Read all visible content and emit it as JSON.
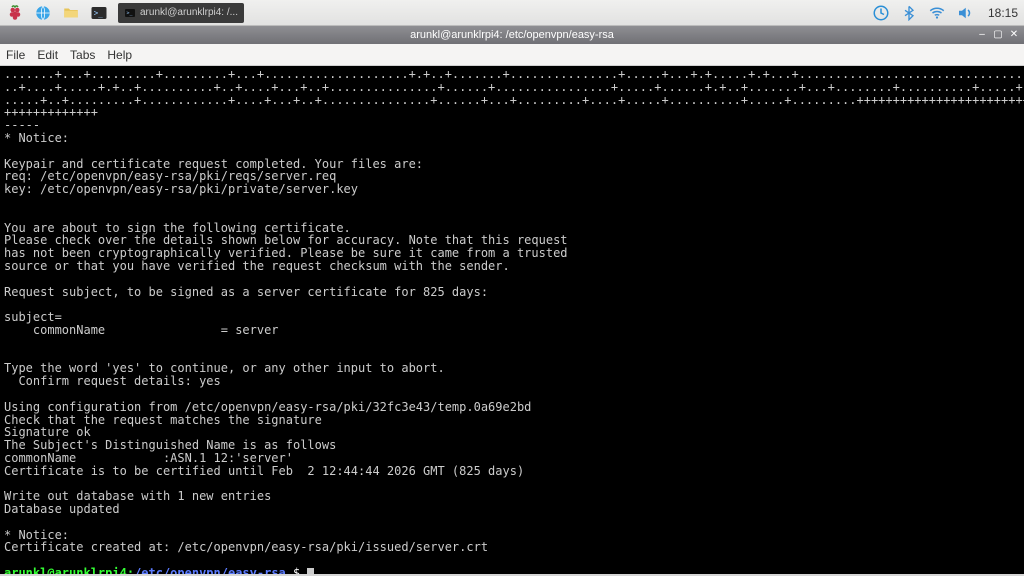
{
  "panel": {
    "tasks": [
      {
        "label": "arunkl@arunklrpi4: /..."
      }
    ],
    "clock": "18:15"
  },
  "window": {
    "title": "arunkl@arunklrpi4: /etc/openvpn/easy-rsa"
  },
  "menubar": [
    "File",
    "Edit",
    "Tabs",
    "Help"
  ],
  "terminal": {
    "lines": [
      ".......+...+.........+.........+...+....................+.+..+.......+...............+.....+...+.+.....+.+...+......................................+.....+.+.....+.",
      "..+....+.....+.+..+..........+..+....+...+..+...............+......+................+.....+......+.+..+.......+...+........+..........+.....+.+......+.....+...+.....",
      ".....+..+.........+............+....+...+..+...............+......+...+.........+....+.....+..........+.....+.........+++++++++++++++++++++++++++++++++++++++++++++++",
      "+++++++++++++",
      "-----",
      "* Notice:",
      "",
      "Keypair and certificate request completed. Your files are:",
      "req: /etc/openvpn/easy-rsa/pki/reqs/server.req",
      "key: /etc/openvpn/easy-rsa/pki/private/server.key",
      "",
      "",
      "You are about to sign the following certificate.",
      "Please check over the details shown below for accuracy. Note that this request",
      "has not been cryptographically verified. Please be sure it came from a trusted",
      "source or that you have verified the request checksum with the sender.",
      "",
      "Request subject, to be signed as a server certificate for 825 days:",
      "",
      "subject=",
      "    commonName                = server",
      "",
      "",
      "Type the word 'yes' to continue, or any other input to abort.",
      "  Confirm request details: yes",
      "",
      "Using configuration from /etc/openvpn/easy-rsa/pki/32fc3e43/temp.0a69e2bd",
      "Check that the request matches the signature",
      "Signature ok",
      "The Subject's Distinguished Name is as follows",
      "commonName            :ASN.1 12:'server'",
      "Certificate is to be certified until Feb  2 12:44:44 2026 GMT (825 days)",
      "",
      "Write out database with 1 new entries",
      "Database updated",
      "",
      "* Notice:",
      "Certificate created at: /etc/openvpn/easy-rsa/pki/issued/server.crt",
      ""
    ],
    "prompt": {
      "user": "arunkl@arunklrpi4",
      "sep": ":",
      "path": "/etc/openvpn/easy-rsa",
      "dollar": " $ "
    }
  }
}
